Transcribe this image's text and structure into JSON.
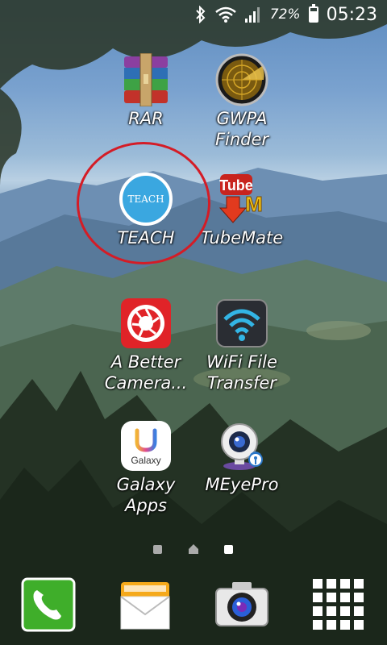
{
  "status_bar": {
    "battery_text": "72%",
    "time": "05:23",
    "battery_level": 0.72,
    "icons": [
      "bluetooth-icon",
      "wifi-icon",
      "signal-icon",
      "battery-icon"
    ]
  },
  "apps": [
    {
      "label": "RAR",
      "icon": "rar-icon"
    },
    {
      "label": "GWPA\nFinder",
      "icon": "gwpa-finder-icon"
    },
    {
      "label": "TEACH",
      "icon": "teach-icon",
      "icon_text": "TEACH"
    },
    {
      "label": "TubeMate",
      "icon": "tubemate-icon",
      "icon_text_top": "Tube",
      "icon_text_letter": "M"
    },
    {
      "label": "A Better\nCamera...",
      "icon": "a-better-camera-icon"
    },
    {
      "label": "WiFi File\nTransfer",
      "icon": "wifi-file-transfer-icon"
    },
    {
      "label": "Galaxy\nApps",
      "icon": "galaxy-apps-icon",
      "icon_text": "Galaxy"
    },
    {
      "label": "MEyePro",
      "icon": "meyepro-icon"
    }
  ],
  "page_indicator": {
    "pages": 3,
    "home_index": 1,
    "current_index": 2
  },
  "dock": [
    {
      "name": "phone",
      "icon": "phone-icon"
    },
    {
      "name": "messages",
      "icon": "messages-icon"
    },
    {
      "name": "camera",
      "icon": "camera-icon"
    },
    {
      "name": "apps",
      "icon": "apps-grid-icon"
    }
  ],
  "colors": {
    "highlight": "#d41c26",
    "teach": "#3aa7e0",
    "phone": "#3fae2a",
    "rar_purple": "#8b3fa0"
  }
}
